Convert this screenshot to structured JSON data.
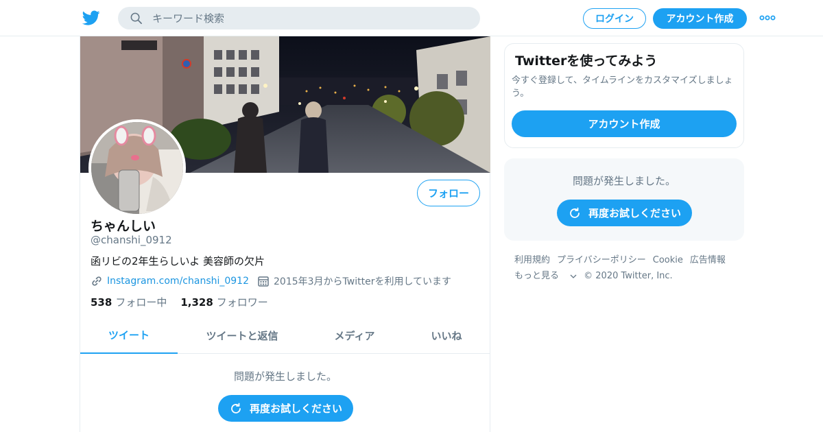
{
  "colors": {
    "accent": "#1da1f2",
    "link": "#1b95e0",
    "muted": "#657786",
    "border": "#e6ecf0",
    "panel_bg": "#f5f8fa"
  },
  "header": {
    "logo_icon": "twitter-bird-icon",
    "search_placeholder": "キーワード検索",
    "login_label": "ログイン",
    "signup_label": "アカウント作成",
    "more_icon": "more-dots-icon"
  },
  "profile": {
    "display_name": "ちゃんしい",
    "handle": "@chanshi_0912",
    "bio": "函リビの2年生らしいよ  美容師の欠片",
    "url": "Instagram.com/chanshi_0912",
    "joined": "2015年3月からTwitterを利用しています",
    "follow_label": "フォロー",
    "following_count": "538",
    "following_label": "フォロー中",
    "followers_count": "1,328",
    "followers_label": "フォロワー"
  },
  "tabs": [
    {
      "label": "ツイート",
      "active": true
    },
    {
      "label": "ツイートと返信",
      "active": false
    },
    {
      "label": "メディア",
      "active": false
    },
    {
      "label": "いいね",
      "active": false
    }
  ],
  "timeline": {
    "error_text": "問題が発生しました。",
    "retry_label": "再度お試しください"
  },
  "sidebar": {
    "signup_card": {
      "title": "Twitterを使ってみよう",
      "description": "今すぐ登録して、タイムラインをカスタマイズしましょう。",
      "button_label": "アカウント作成"
    },
    "error_card": {
      "error_text": "問題が発生しました。",
      "retry_label": "再度お試しください"
    }
  },
  "footer": {
    "links": [
      "利用規約",
      "プライバシーポリシー",
      "Cookie",
      "広告情報"
    ],
    "more_label": "もっと見る",
    "copyright": "© 2020 Twitter, Inc."
  }
}
